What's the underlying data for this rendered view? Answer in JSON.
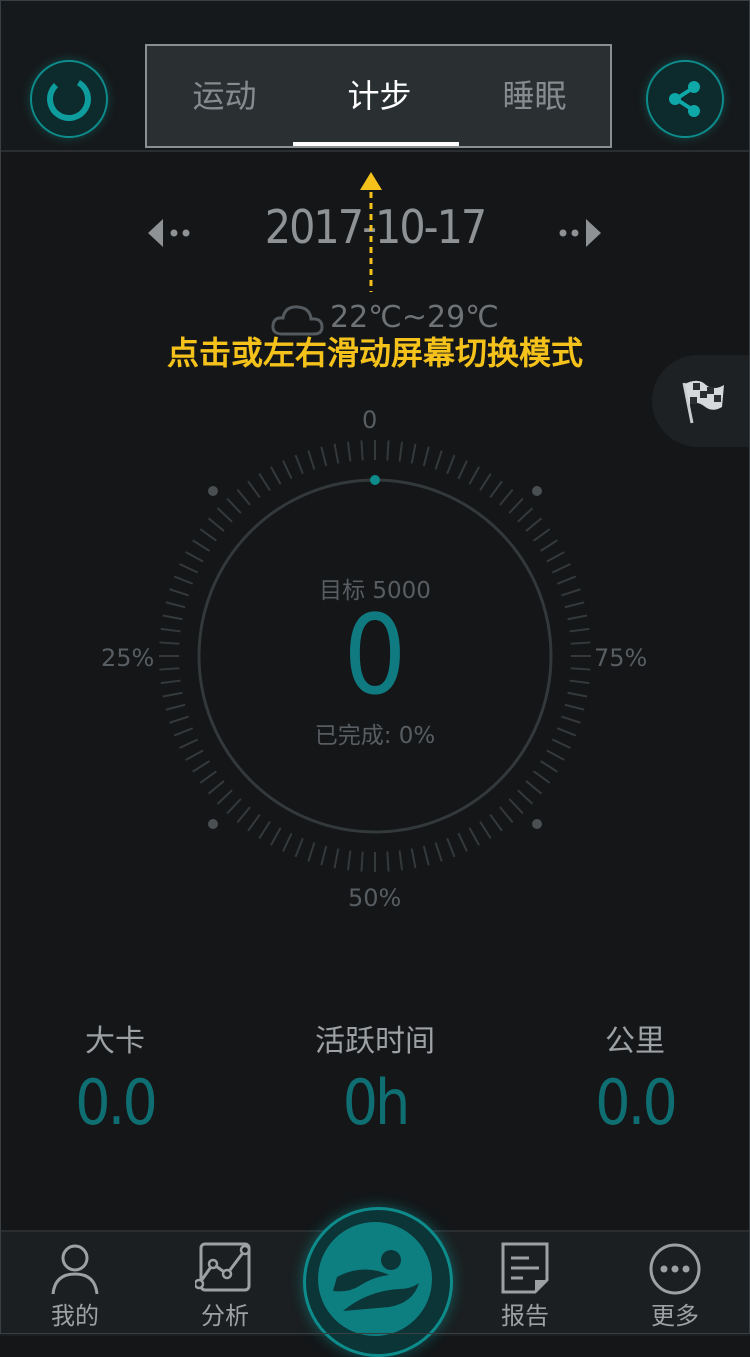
{
  "header": {
    "tabs": [
      {
        "label": "运动",
        "active": false
      },
      {
        "label": "计步",
        "active": true
      },
      {
        "label": "睡眠",
        "active": false
      }
    ],
    "left_icon": "sync-ring-icon",
    "right_icon": "share-icon"
  },
  "date": {
    "value": "2017-10-17",
    "prev_icon": "prev-day-arrow-icon",
    "next_icon": "next-day-arrow-icon"
  },
  "weather": {
    "icon": "cloud-icon",
    "temperature": "22℃~29℃"
  },
  "hint": {
    "text": "点击或左右滑动屏幕切换模式",
    "color": "#f4c21a"
  },
  "side": {
    "flag_icon": "checkered-flag-icon"
  },
  "dial": {
    "label_top": "0",
    "label_right": "75%",
    "label_bottom": "50%",
    "label_left": "25%",
    "goal": "目标 5000",
    "steps": "0",
    "completion": "已完成: 0%",
    "progress": 0
  },
  "stats": [
    {
      "label": "大卡",
      "value": "0.0"
    },
    {
      "label": "活跃时间",
      "value": "0h"
    },
    {
      "label": "公里",
      "value": "0.0"
    }
  ],
  "bottom_nav": [
    {
      "label": "我的",
      "icon": "person-icon"
    },
    {
      "label": "分析",
      "icon": "chart-icon"
    },
    {
      "label": "",
      "icon": "swift-logo-icon"
    },
    {
      "label": "报告",
      "icon": "report-icon"
    },
    {
      "label": "更多",
      "icon": "more-icon"
    }
  ],
  "colors": {
    "accent": "#0e8c8c",
    "background": "#141618",
    "hint": "#f4c21a"
  }
}
